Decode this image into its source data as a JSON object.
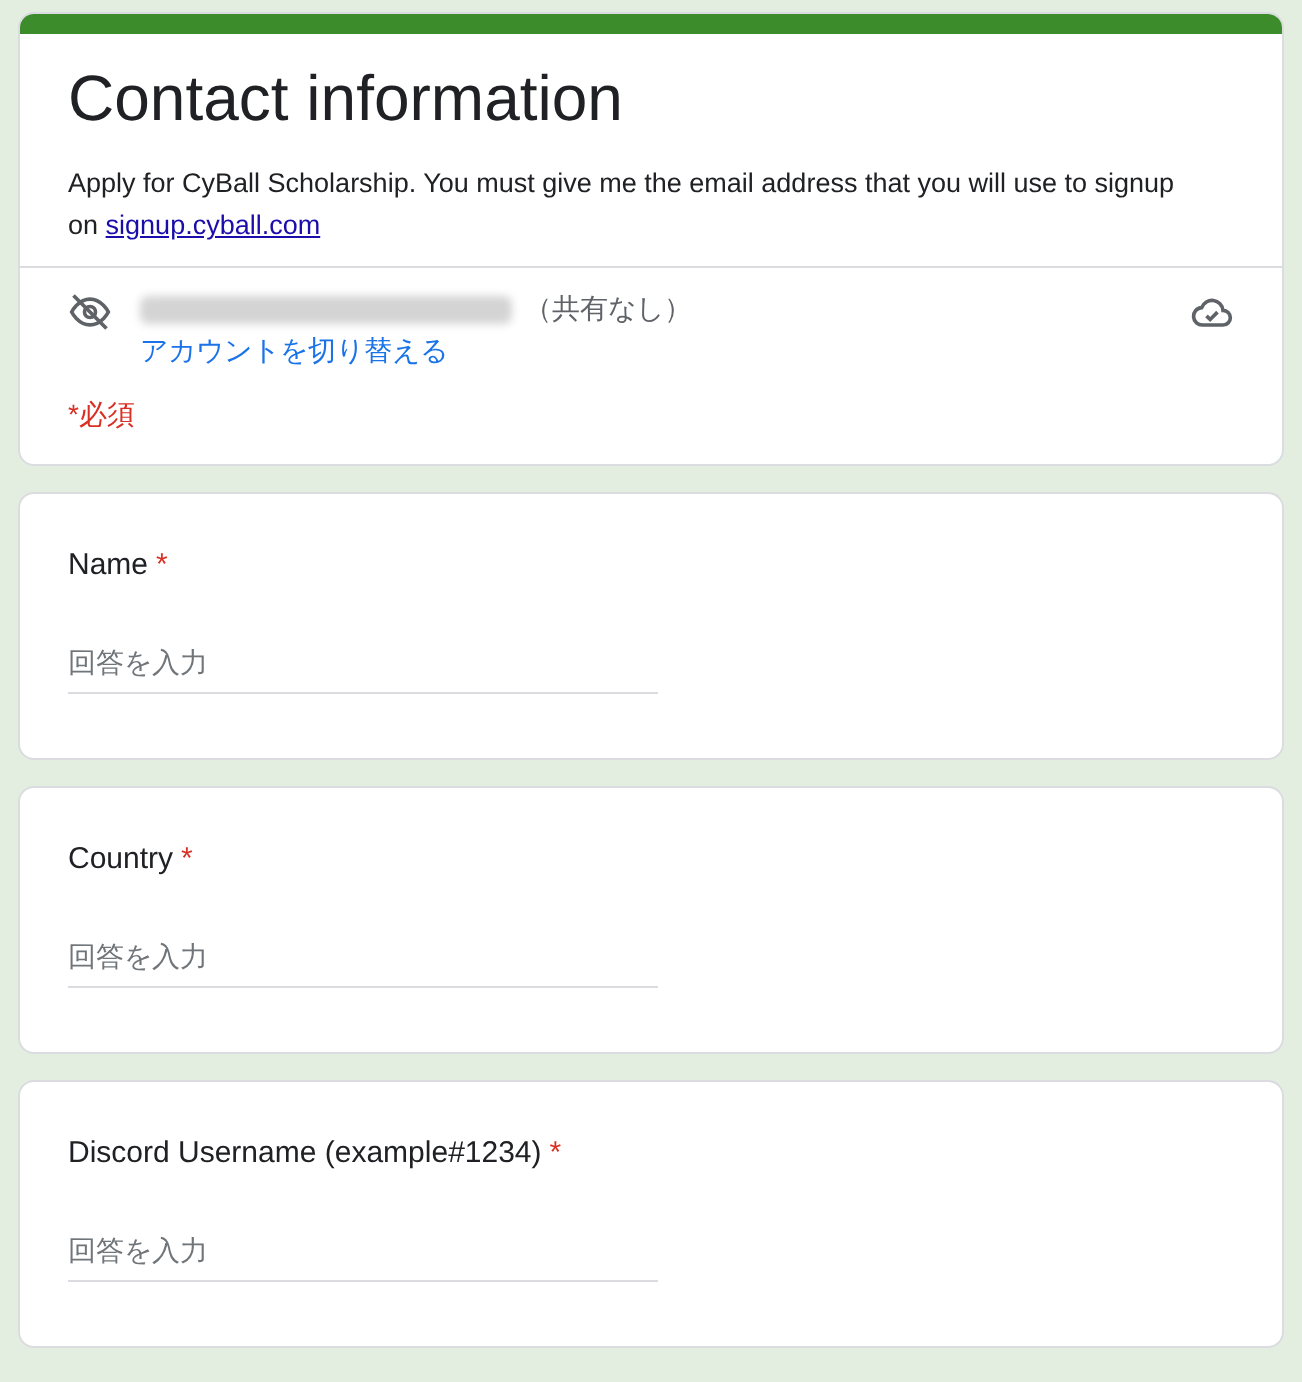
{
  "header": {
    "title": "Contact information",
    "description": "Apply for CyBall Scholarship. You must give me the email address that you will use to signup on",
    "link": "signup.cyball.com"
  },
  "account": {
    "email_hidden": true,
    "sharing_note": "（共有なし）",
    "switch_link": "アカウントを切り替える"
  },
  "required_note": "*必須",
  "questions": [
    {
      "label": "Name",
      "required": true,
      "required_mark": "*",
      "placeholder": "回答を入力"
    },
    {
      "label": "Country",
      "required": true,
      "required_mark": "*",
      "placeholder": "回答を入力"
    },
    {
      "label": "Discord Username (example#1234)",
      "required": true,
      "required_mark": "*",
      "placeholder": "回答を入力"
    }
  ]
}
